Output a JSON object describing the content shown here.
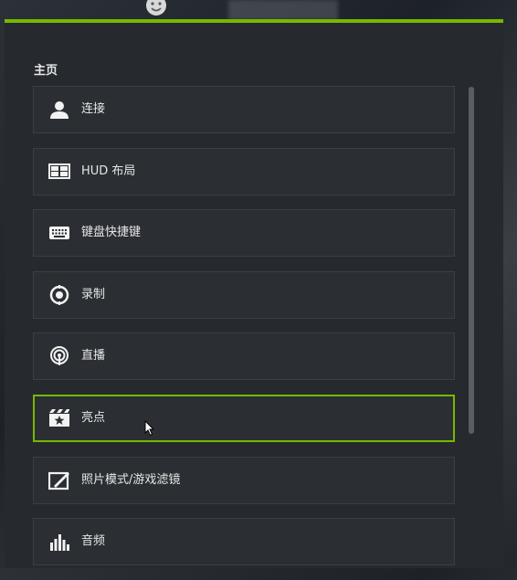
{
  "panel": {
    "title": "主页"
  },
  "menu": [
    {
      "label": "连接",
      "icon": "person-icon"
    },
    {
      "label": "HUD 布局",
      "icon": "layout-icon"
    },
    {
      "label": "键盘快捷键",
      "icon": "keyboard-icon"
    },
    {
      "label": "录制",
      "icon": "record-icon"
    },
    {
      "label": "直播",
      "icon": "broadcast-icon"
    },
    {
      "label": "亮点",
      "icon": "highlights-icon",
      "selected": true
    },
    {
      "label": "照片模式/游戏滤镜",
      "icon": "photo-filter-icon"
    },
    {
      "label": "音频",
      "icon": "audio-icon"
    }
  ],
  "colors": {
    "accent": "#76b900",
    "panel_bg": "#262a2e",
    "item_bg": "#2b2f33",
    "text": "#e6e6e6"
  }
}
